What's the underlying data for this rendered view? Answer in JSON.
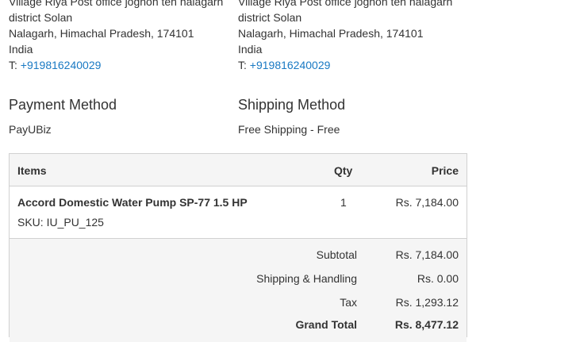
{
  "billing_address": {
    "lines": [
      "Village Riya Post office joghon teh nalagarh",
      "district Solan",
      "Nalagarh, Himachal Pradesh, 174101",
      "India"
    ],
    "phone_prefix": "T: ",
    "phone": "+919816240029"
  },
  "shipping_address": {
    "lines": [
      "Village Riya Post office joghon teh nalagarh",
      "district Solan",
      "Nalagarh, Himachal Pradesh, 174101",
      "India"
    ],
    "phone_prefix": "T: ",
    "phone": "+919816240029"
  },
  "payment_method": {
    "title": "Payment Method",
    "value": "PayUBiz"
  },
  "shipping_method": {
    "title": "Shipping Method",
    "value": "Free Shipping - Free"
  },
  "items_table": {
    "headers": {
      "items": "Items",
      "qty": "Qty",
      "price": "Price"
    },
    "rows": [
      {
        "name": "Accord Domestic Water Pump SP-77 1.5 HP",
        "sku": "SKU: IU_PU_125",
        "qty": "1",
        "price": "Rs. 7,184.00"
      }
    ]
  },
  "totals": {
    "subtotal_label": "Subtotal",
    "subtotal": "Rs. 7,184.00",
    "shipping_label": "Shipping & Handling",
    "shipping": "Rs. 0.00",
    "tax_label": "Tax",
    "tax": "Rs. 1,293.12",
    "grand_label": "Grand Total",
    "grand": "Rs. 8,477.12"
  },
  "colors": {
    "link": "#1979c3",
    "table_header_bg": "#f5f5f5",
    "border": "#d1d1d1"
  }
}
